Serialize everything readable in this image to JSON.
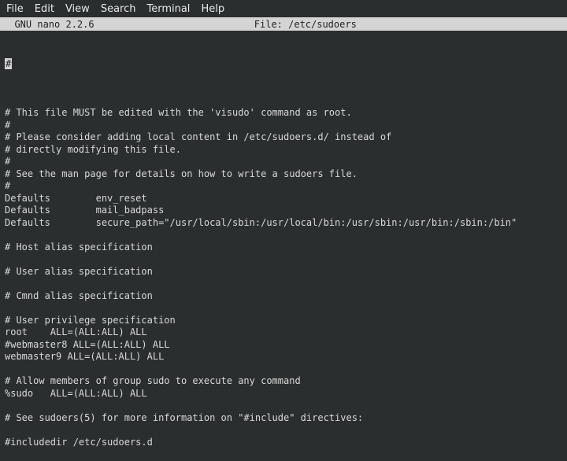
{
  "menubar": {
    "file": "File",
    "edit": "Edit",
    "view": "View",
    "search": "Search",
    "terminal": "Terminal",
    "help": "Help"
  },
  "titlebar": {
    "left": "  GNU nano 2.2.6",
    "center": "File: /etc/sudoers"
  },
  "editor": {
    "first_hash": "#",
    "lines": [
      "",
      "# This file MUST be edited with the 'visudo' command as root.",
      "#",
      "# Please consider adding local content in /etc/sudoers.d/ instead of",
      "# directly modifying this file.",
      "#",
      "# See the man page for details on how to write a sudoers file.",
      "#",
      "Defaults        env_reset",
      "Defaults        mail_badpass",
      "Defaults        secure_path=\"/usr/local/sbin:/usr/local/bin:/usr/sbin:/usr/bin:/sbin:/bin\"",
      "",
      "# Host alias specification",
      "",
      "# User alias specification",
      "",
      "# Cmnd alias specification",
      "",
      "# User privilege specification",
      "root    ALL=(ALL:ALL) ALL",
      "#webmaster8 ALL=(ALL:ALL) ALL",
      "webmaster9 ALL=(ALL:ALL) ALL",
      "",
      "# Allow members of group sudo to execute any command",
      "%sudo   ALL=(ALL:ALL) ALL",
      "",
      "# See sudoers(5) for more information on \"#include\" directives:",
      "",
      "#includedir /etc/sudoers.d"
    ]
  }
}
